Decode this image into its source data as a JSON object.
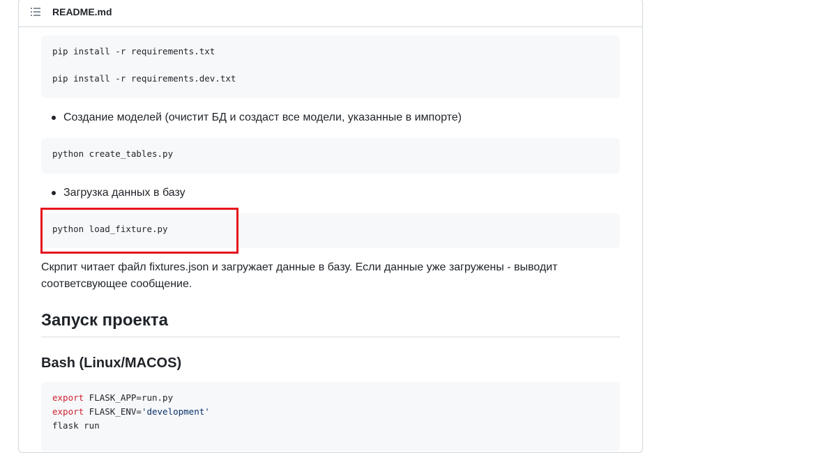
{
  "header": {
    "title": "README.md",
    "toc_icon": "list-unordered-icon"
  },
  "content": {
    "code_block_1": {
      "lines": [
        "pip install -r requirements.txt",
        "pip install -r requirements.dev.txt"
      ]
    },
    "bullet_1": "Создание моделей (очистит БД и создаст все модели, указанные в импорте)",
    "code_block_2": {
      "lines": [
        "python create_tables.py"
      ]
    },
    "bullet_2": "Загрузка данных в базу",
    "code_block_3": {
      "lines": [
        "python load_fixture.py"
      ]
    },
    "paragraph": "Скрпит читает файл fixtures.json и загружает данные в базу. Если данные уже загружены - выводит соответсвующее сообщение.",
    "heading_run": "Запуск проекта",
    "heading_bash": "Bash (Linux/MACOS)",
    "code_block_4": {
      "line1_kw": "export",
      "line1_rest": " FLASK_APP=run.py",
      "line2_kw": "export",
      "line2_rest": " FLASK_ENV=",
      "line2_str": "'development'",
      "line3": "flask run"
    }
  },
  "colors": {
    "highlight_border": "#e5131d",
    "code_background": "#f6f8fa",
    "keyword": "#cf222e"
  }
}
